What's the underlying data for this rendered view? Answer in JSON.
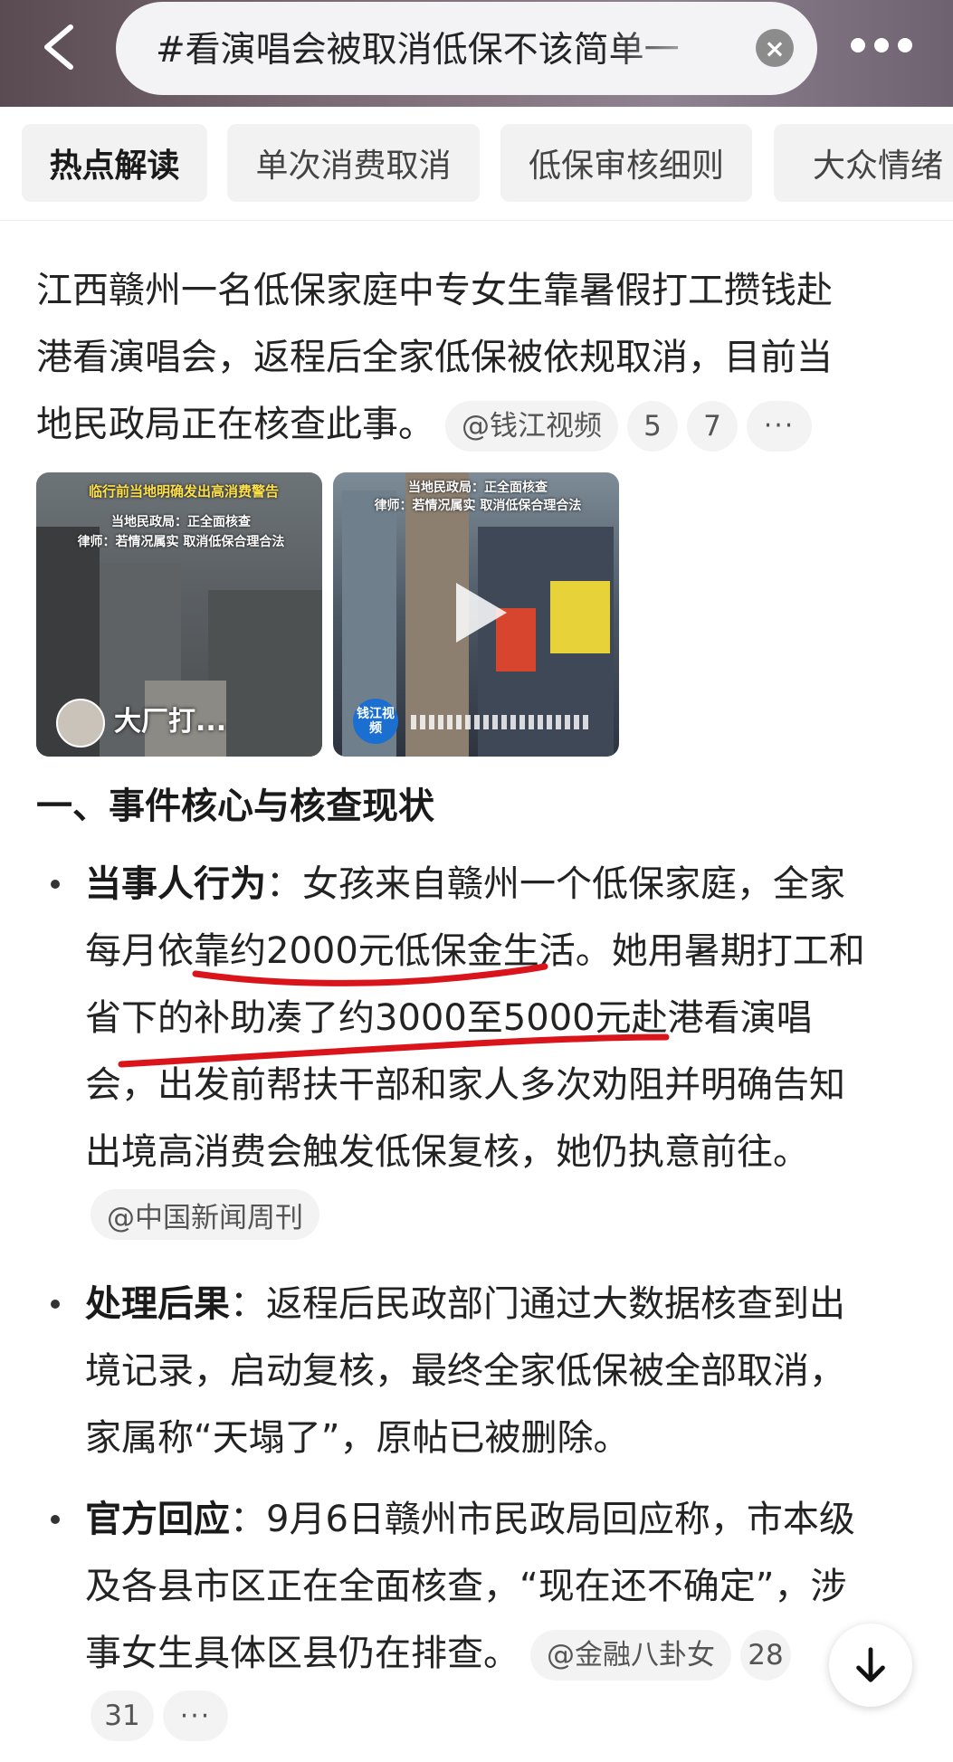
{
  "header": {
    "search_text": "#看演唱会被取消低保不该简单一",
    "clear_icon": "close-circle-icon",
    "back_icon": "chevron-left-icon",
    "more_icon": "more-horizontal-icon"
  },
  "tabs": [
    {
      "label": "热点解读"
    },
    {
      "label": "单次消费取消"
    },
    {
      "label": "低保审核细则"
    },
    {
      "label": "大众情绪"
    }
  ],
  "intro": {
    "line1": "江西赣州一名低保家庭中专女生靠暑假打工攒钱赴",
    "line2": "港看演唱会，返程后全家低保被依规取消，目前当",
    "line3": "地民政局正在核查此事。",
    "source": "@钱江视频",
    "ref1": "5",
    "ref2": "7",
    "more": "···"
  },
  "media": [
    {
      "caption_top": "临行前当地明确发出高消费警告",
      "caption_mid": "当地民政局：正全面核查",
      "caption_bot": "律师：若情况属实 取消低保合理合法",
      "author": "大厂打..."
    },
    {
      "caption_top": "当地民政局：正全面核查",
      "caption_mid": "律师：若情况属实 取消低保合理合法",
      "logo": "钱江视频",
      "play_icon": "play-icon"
    }
  ],
  "section_heading": "一、事件核心与核查现状",
  "items": [
    {
      "label": "当事人行为",
      "colon": "：",
      "l1": "女孩来自赣州一个低保家庭，全家",
      "l2": "每月依靠约2000元低保金生活。她用暑期打工和",
      "l3": "省下的补助凑了约3000至5000元赴港看演唱",
      "l4": "会，出发前帮扶干部和家人多次劝阻并明确告知",
      "l5": "出境高消费会触发低保复核，她仍执意前往。",
      "source": "@中国新闻周刊"
    },
    {
      "label": "处理后果",
      "colon": "：",
      "l1": "返程后民政部门通过大数据核查到出",
      "l2": "境记录，启动复核，最终全家低保被全部取消，",
      "l3": "家属称“天塌了”，原帖已被删除。"
    },
    {
      "label": "官方回应",
      "colon": "：",
      "l1": "9月6日赣州市民政局回应称，市本级",
      "l2": "及各县市区正在全面核查，“现在还不确定”，涉",
      "l3": "事女生具体区县仍在排查。",
      "source": "@金融八卦女",
      "ref1": "28",
      "ref2": "31",
      "more": "···"
    }
  ],
  "scroll_down_icon": "arrow-down-icon",
  "colors": {
    "header_bg": "#6e6270",
    "annotation_red": "#d9141b",
    "chip_bg": "#f2f2f2"
  }
}
